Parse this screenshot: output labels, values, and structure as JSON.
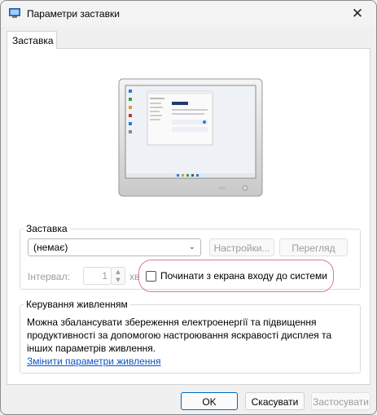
{
  "window": {
    "title": "Параметри заставки",
    "close_glyph": "✕"
  },
  "tabs": [
    {
      "label": "Заставка"
    }
  ],
  "screensaver": {
    "group_label": "Заставка",
    "selected": "(немає)",
    "settings_label": "Настройки...",
    "preview_label": "Перегляд",
    "interval_label": "Інтервал:",
    "interval_value": "1",
    "interval_unit": "хв",
    "resume_label": "Починати з екрана входу до системи",
    "resume_checked": false
  },
  "power": {
    "group_label": "Керування живленням",
    "description": "Можна збалансувати збереження електроенергії та підвищення продуктивності за допомогою настроювання яскравості дисплея та інших параметрів живлення.",
    "link": "Змінити параметри живлення"
  },
  "footer": {
    "ok_label": "OK",
    "cancel_label": "Скасувати",
    "apply_label": "Застосувати"
  },
  "colors": {
    "accent": "#0067c0",
    "link": "#0a55c8",
    "highlight": "#e07a8a",
    "disabled_text": "#9c9c9c"
  }
}
